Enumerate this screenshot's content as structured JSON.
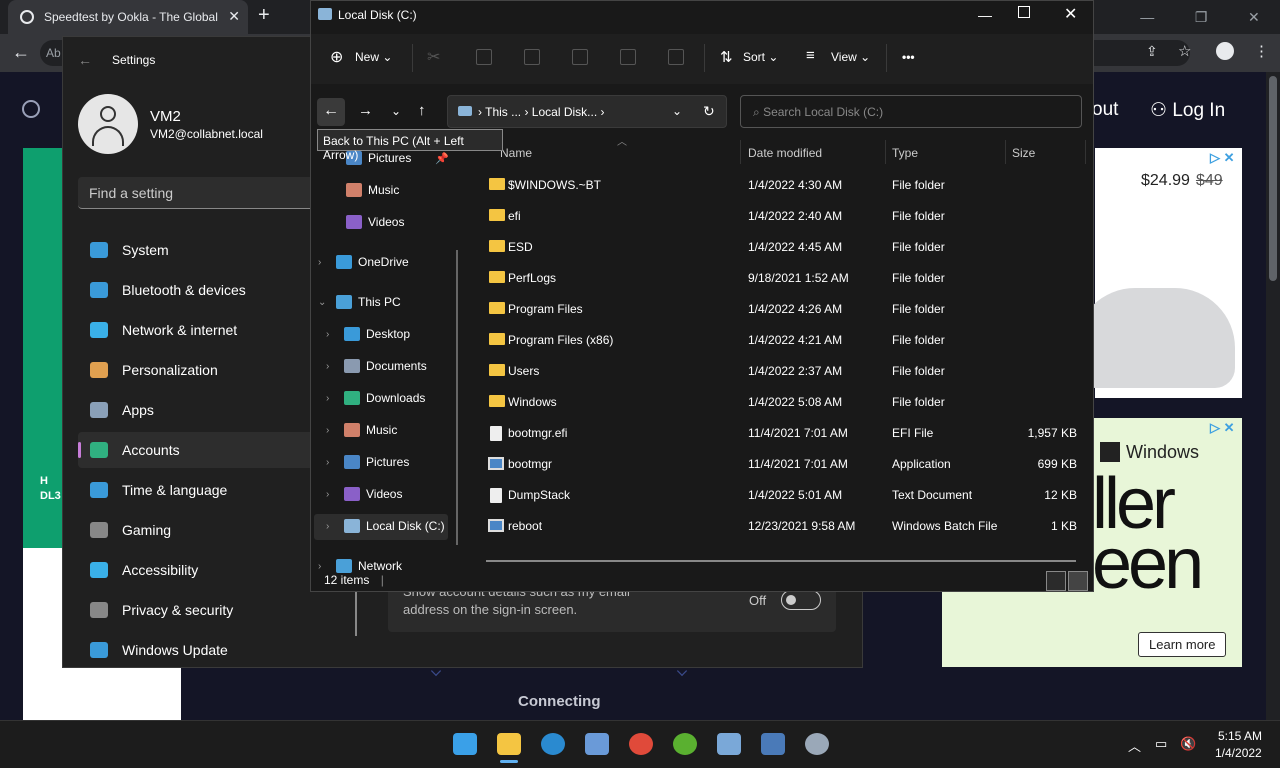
{
  "browser": {
    "tab_title": "Speedtest by Ookla - The Global",
    "omnibox_prefix": "Ab",
    "nav_about": "out",
    "nav_login": "Log In",
    "ad1_price": "$24.99",
    "ad1_old_price": "$49",
    "ad2_brand": "Windows",
    "ad2_big_text": "ller\neen",
    "ad2_cta": "Learn more",
    "left_ad_text": "H\nDL3",
    "connecting": "Connecting"
  },
  "settings": {
    "title": "Settings",
    "user_name": "VM2",
    "user_email": "VM2@collabnet.local",
    "search_placeholder": "Find a setting",
    "nav": [
      {
        "label": "System",
        "color": "#3a9ad9"
      },
      {
        "label": "Bluetooth & devices",
        "color": "#3a9ad9"
      },
      {
        "label": "Network & internet",
        "color": "#3ab0e8"
      },
      {
        "label": "Personalization",
        "color": "#e0a050"
      },
      {
        "label": "Apps",
        "color": "#8aa0b8"
      },
      {
        "label": "Accounts",
        "color": "#30b080"
      },
      {
        "label": "Time & language",
        "color": "#3a9ad9"
      },
      {
        "label": "Gaming",
        "color": "#888888"
      },
      {
        "label": "Accessibility",
        "color": "#3ab0e8"
      },
      {
        "label": "Privacy & security",
        "color": "#888888"
      },
      {
        "label": "Windows Update",
        "color": "#3a9ad9"
      }
    ],
    "selected": "Accounts",
    "account_detail_line1": "Show account details such as my email",
    "account_detail_line2": "address on the sign-in screen.",
    "toggle_state": "Off"
  },
  "explorer": {
    "title": "Local Disk (C:)",
    "toolbar": {
      "new": "New",
      "sort": "Sort",
      "view": "View",
      "more": "•••"
    },
    "address": "This ...  ›  Local Disk...  ›",
    "address_prefix": "›",
    "search_placeholder": "Search Local Disk (C:)",
    "tooltip": "Back to This PC (Alt + Left Arrow)",
    "tree": [
      {
        "label": "Pictures",
        "color": "#4a86c6"
      },
      {
        "label": "Music",
        "color": "#d0806a"
      },
      {
        "label": "Videos",
        "color": "#8a60c8"
      },
      {
        "label": "OneDrive",
        "color": "#3a9ad9"
      },
      {
        "label": "This PC",
        "color": "#4aa0d8"
      },
      {
        "label": "Desktop",
        "color": "#3a9ad9"
      },
      {
        "label": "Documents",
        "color": "#8a9ab0"
      },
      {
        "label": "Downloads",
        "color": "#30b080"
      },
      {
        "label": "Music",
        "color": "#d0806a"
      },
      {
        "label": "Pictures",
        "color": "#4a86c6"
      },
      {
        "label": "Videos",
        "color": "#8a60c8"
      },
      {
        "label": "Local Disk (C:)",
        "color": "#8ab4d8"
      },
      {
        "label": "Network",
        "color": "#4aa0d8"
      }
    ],
    "columns": [
      "Name",
      "Date modified",
      "Type",
      "Size"
    ],
    "rows": [
      {
        "name": "$WINDOWS.~BT",
        "date": "1/4/2022 4:30 AM",
        "type": "File folder",
        "size": "",
        "icon": "folder"
      },
      {
        "name": "efi",
        "date": "1/4/2022 2:40 AM",
        "type": "File folder",
        "size": "",
        "icon": "folder"
      },
      {
        "name": "ESD",
        "date": "1/4/2022 4:45 AM",
        "type": "File folder",
        "size": "",
        "icon": "folder"
      },
      {
        "name": "PerfLogs",
        "date": "9/18/2021 1:52 AM",
        "type": "File folder",
        "size": "",
        "icon": "folder"
      },
      {
        "name": "Program Files",
        "date": "1/4/2022 4:26 AM",
        "type": "File folder",
        "size": "",
        "icon": "folder"
      },
      {
        "name": "Program Files (x86)",
        "date": "1/4/2022 4:21 AM",
        "type": "File folder",
        "size": "",
        "icon": "folder"
      },
      {
        "name": "Users",
        "date": "1/4/2022 2:37 AM",
        "type": "File folder",
        "size": "",
        "icon": "folder"
      },
      {
        "name": "Windows",
        "date": "1/4/2022 5:08 AM",
        "type": "File folder",
        "size": "",
        "icon": "folder"
      },
      {
        "name": "bootmgr.efi",
        "date": "11/4/2021 7:01 AM",
        "type": "EFI File",
        "size": "1,957 KB",
        "icon": "file"
      },
      {
        "name": "bootmgr",
        "date": "11/4/2021 7:01 AM",
        "type": "Application",
        "size": "699 KB",
        "icon": "app"
      },
      {
        "name": "DumpStack",
        "date": "1/4/2022 5:01 AM",
        "type": "Text Document",
        "size": "12 KB",
        "icon": "file"
      },
      {
        "name": "reboot",
        "date": "12/23/2021 9:58 AM",
        "type": "Windows Batch File",
        "size": "1 KB",
        "icon": "app"
      }
    ],
    "status": "12 items"
  },
  "taskbar": {
    "apps": [
      "windows-start",
      "file-explorer",
      "edge",
      "store",
      "chrome",
      "utorrent",
      "resource-monitor",
      "window-app",
      "settings"
    ],
    "time": "5:15 AM",
    "date": "1/4/2022"
  }
}
